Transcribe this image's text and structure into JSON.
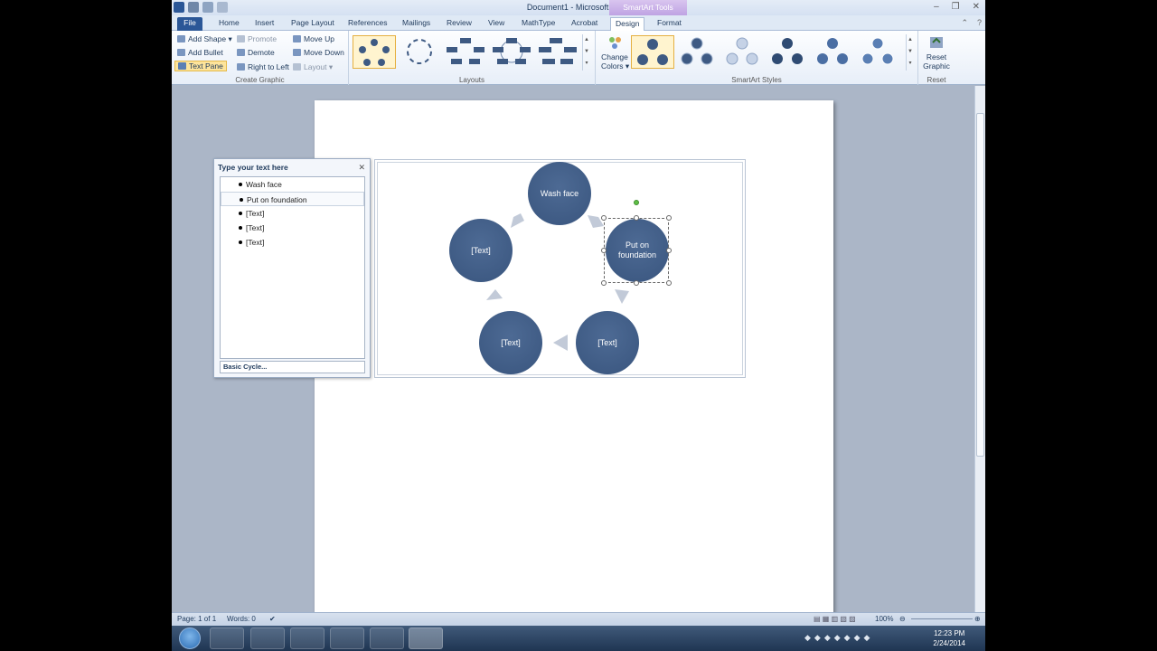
{
  "window": {
    "title": "Document1 - Microsoft Word",
    "contextual_tab_group": "SmartArt Tools",
    "minimize": "–",
    "maximize": "❐",
    "close": "✕"
  },
  "tabs": [
    {
      "label": "File"
    },
    {
      "label": "Home"
    },
    {
      "label": "Insert"
    },
    {
      "label": "Page Layout"
    },
    {
      "label": "References"
    },
    {
      "label": "Mailings"
    },
    {
      "label": "Review"
    },
    {
      "label": "View"
    },
    {
      "label": "MathType"
    },
    {
      "label": "Acrobat"
    },
    {
      "label": "Design"
    },
    {
      "label": "Format"
    }
  ],
  "ribbon": {
    "create_graphic": {
      "label": "Create Graphic",
      "add_shape": "Add Shape",
      "add_bullet": "Add Bullet",
      "text_pane": "Text Pane",
      "promote": "Promote",
      "demote": "Demote",
      "right_to_left": "Right to Left",
      "move_up": "Move Up",
      "move_down": "Move Down",
      "layout": "Layout"
    },
    "layouts": {
      "label": "Layouts"
    },
    "smartart_styles": {
      "label": "SmartArt Styles",
      "change_colors_line1": "Change",
      "change_colors_line2": "Colors"
    },
    "reset": {
      "label": "Reset",
      "reset_graphic_line1": "Reset",
      "reset_graphic_line2": "Graphic"
    }
  },
  "text_pane": {
    "title": "Type your text here",
    "close": "✕",
    "items": [
      "Wash face",
      "Put on foundation",
      "[Text]",
      "[Text]",
      "[Text]"
    ],
    "footer": "Basic Cycle..."
  },
  "smartart": {
    "nodes": [
      {
        "text": "Wash face"
      },
      {
        "text": "Put on foundation"
      },
      {
        "text": "[Text]"
      },
      {
        "text": "[Text]"
      },
      {
        "text": "[Text]"
      }
    ]
  },
  "statusbar": {
    "page": "Page: 1 of 1",
    "words": "Words: 0",
    "zoom": "100%"
  },
  "taskbar": {
    "time": "12:23 PM",
    "date": "2/24/2014"
  },
  "colors": {
    "node_fill": "#3e5a83",
    "accent_file": "#2b5797",
    "contextual": "#bfa3e3"
  }
}
